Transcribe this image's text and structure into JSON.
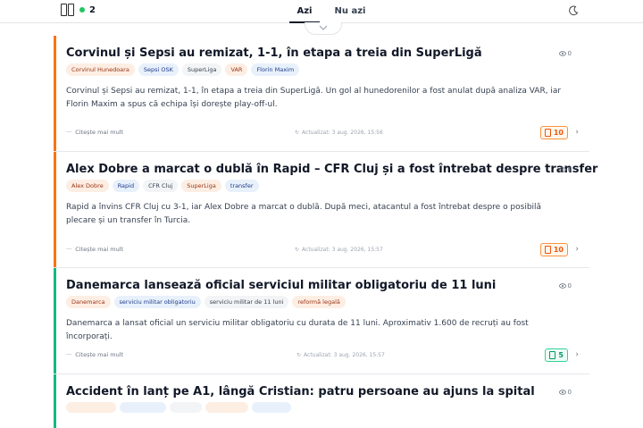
{
  "header": {
    "live_count": "2",
    "tabs": [
      {
        "label": "Azi"
      },
      {
        "label": "Nu azi"
      }
    ]
  },
  "articles": [
    {
      "title": "Corvinul și Sepsi au remizat, 1-1, în etapa a treia din SuperLigă",
      "views": "0",
      "tags": [
        "Corvinul Hunedoara",
        "Sepsi OSK",
        "SuperLiga",
        "VAR",
        "Florin Maxim"
      ],
      "summary": "Corvinul și Sepsi au remizat, 1-1, în etapa a treia din SuperLigă. Un gol al hunedorenilor a fost anulat după analiza VAR, iar Florin Maxim a spus că echipa își dorește play-off-ul.",
      "read_more": "Citește mai mult",
      "updated": "Actualizat: 3 aug. 2026, 15:56",
      "score": "10",
      "accent": "#f97316"
    },
    {
      "title": "Alex Dobre a marcat o dublă în Rapid – CFR Cluj și a fost întrebat despre transfer",
      "views": "0",
      "tags": [
        "Alex Dobre",
        "Rapid",
        "CFR Cluj",
        "SuperLiga",
        "transfer"
      ],
      "summary": "Rapid a învins CFR Cluj cu 3-1, iar Alex Dobre a marcat o dublă. După meci, atacantul a fost întrebat despre o posibilă plecare și un transfer în Turcia.",
      "read_more": "Citește mai mult",
      "updated": "Actualizat: 3 aug. 2026, 15:57",
      "score": "10",
      "accent": "#f97316"
    },
    {
      "title": "Danemarca lansează oficial serviciul militar obligatoriu de 11 luni",
      "views": "0",
      "tags": [
        "Danemarca",
        "serviciu militar obligatoriu",
        "serviciu militar de 11 luni",
        "reformă legală"
      ],
      "summary": "Danemarca a lansat oficial un serviciu militar obligatoriu cu durata de 11 luni. Aproximativ 1.600 de recruți au fost încorporați.",
      "read_more": "Citește mai mult",
      "updated": "Actualizat: 3 aug. 2026, 15:57",
      "score": "5",
      "accent": "#10b981"
    },
    {
      "title": "Accident în lanț pe A1, lângă Cristian: patru persoane au ajuns la spital",
      "views": "0",
      "accent": "#10b981"
    }
  ]
}
